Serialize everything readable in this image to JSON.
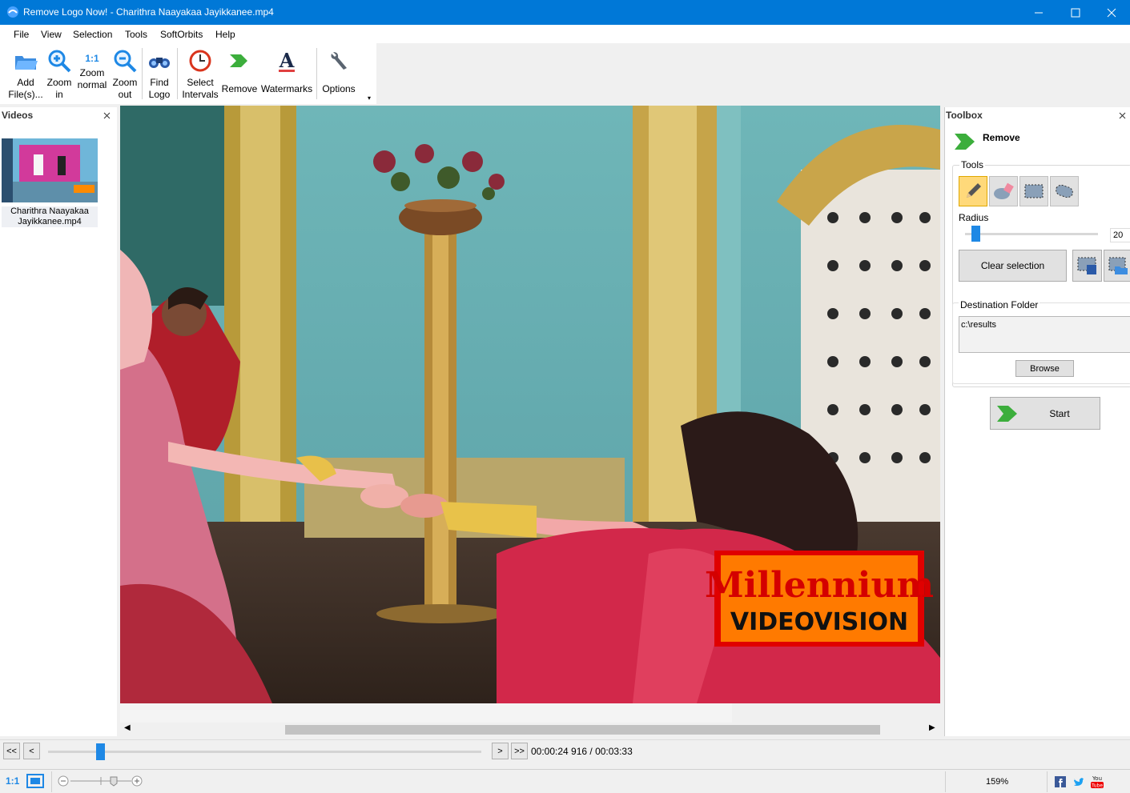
{
  "window": {
    "title": "Remove Logo Now! - Charithra Naayakaa Jayikkanee.mp4"
  },
  "menu": [
    "File",
    "View",
    "Selection",
    "Tools",
    "SoftOrbits",
    "Help"
  ],
  "toolbar": {
    "add": [
      "Add",
      "File(s)..."
    ],
    "zoom_in": [
      "Zoom",
      "in"
    ],
    "zoom_normal": [
      "Zoom",
      "normal"
    ],
    "zoom_normal_glyph": "1:1",
    "zoom_out": [
      "Zoom",
      "out"
    ],
    "find_logo": [
      "Find",
      "Logo"
    ],
    "select_intervals": [
      "Select",
      "Intervals"
    ],
    "remove": "Remove",
    "watermarks": "Watermarks",
    "options": "Options"
  },
  "videos_panel": {
    "title": "Videos",
    "items": [
      {
        "name": "Charithra Naayakaa Jayikkanee.mp4",
        "name_lines": [
          "Charithra Naayakaa",
          "Jayikkanee.mp4"
        ]
      }
    ]
  },
  "preview": {
    "logo_line1": "Millennium",
    "logo_line2": "VIDEOVISION"
  },
  "toolbox": {
    "title": "Toolbox",
    "section": "Remove",
    "tools_label": "Tools",
    "radius_label": "Radius",
    "radius_value": "20",
    "radius_fraction": 0.05,
    "clear_selection": "Clear selection",
    "destination_label": "Destination Folder",
    "destination_value": "c:\\results",
    "browse": "Browse",
    "start": "Start"
  },
  "timeline": {
    "first": "<<",
    "prev": "<",
    "next": ">",
    "last": ">>",
    "time": "00:00:24 916 / 00:03:33",
    "position_fraction": 0.12
  },
  "statusbar": {
    "zoom_glyph": "1:1",
    "zoom_percent": "159%"
  },
  "colors": {
    "titlebar": "#0078d7",
    "accent_green": "#3cae3c",
    "logo_orange": "#ff7a00",
    "logo_red": "#e00000"
  }
}
